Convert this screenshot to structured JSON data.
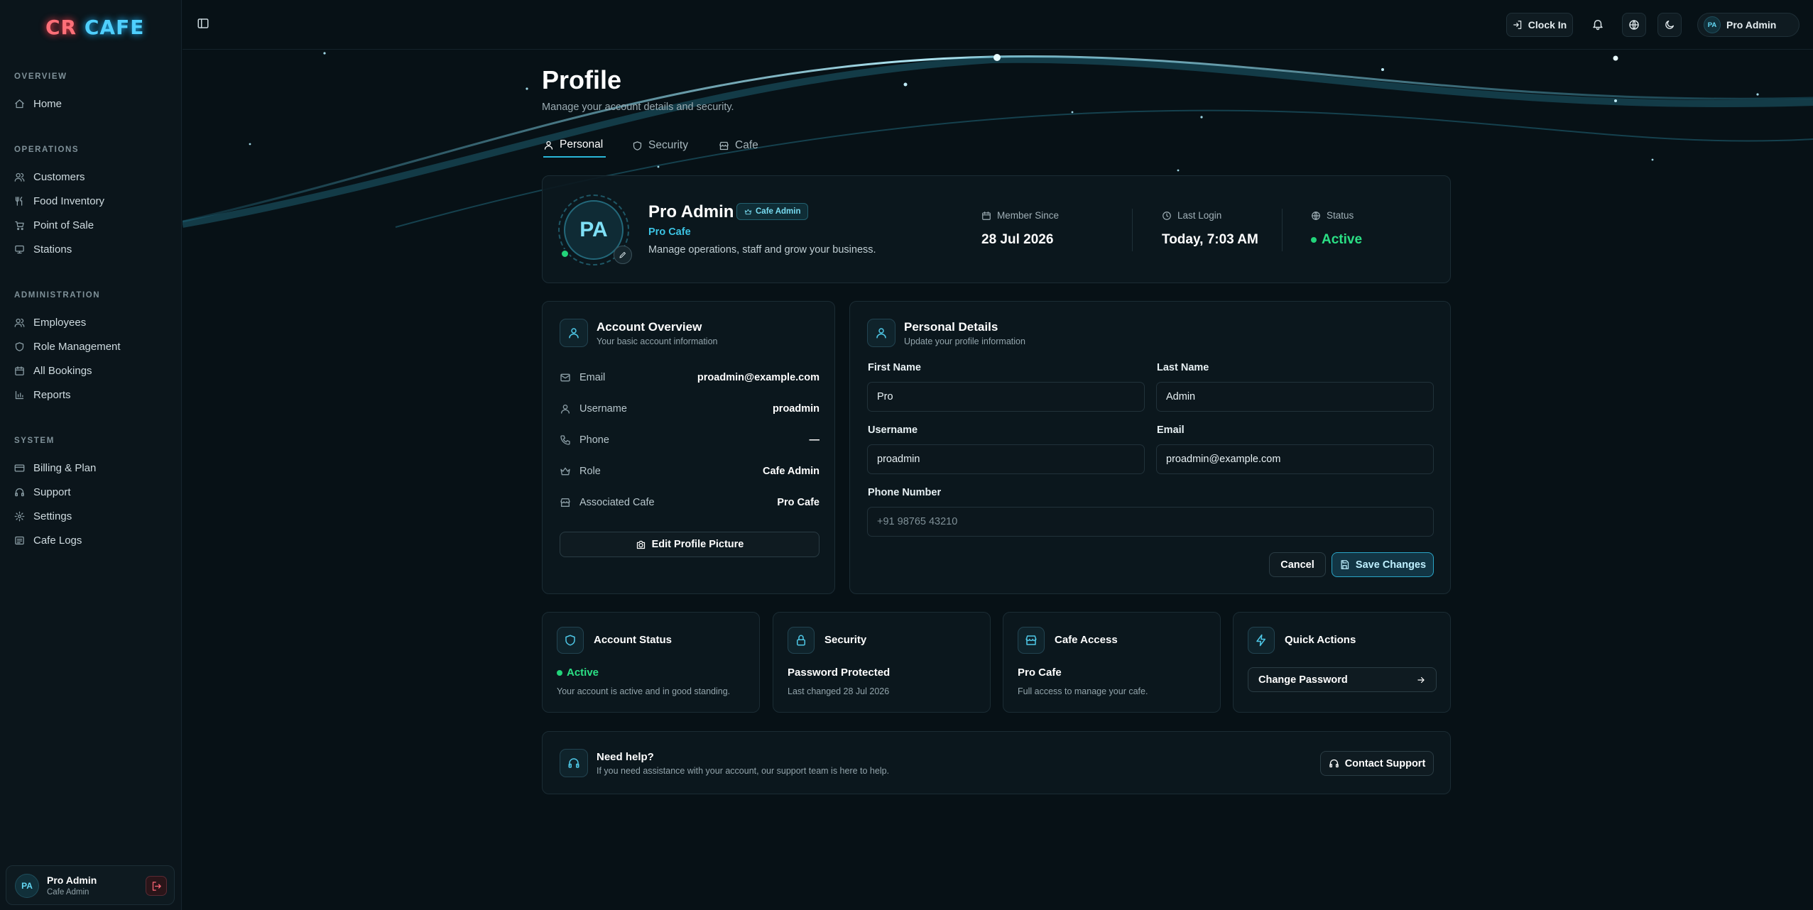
{
  "brand": {
    "logo_left": "CR",
    "logo_right": "CAFE"
  },
  "sidebar": {
    "sections": [
      {
        "title": "OVERVIEW",
        "items": [
          {
            "label": "Home",
            "icon": "home-icon"
          }
        ]
      },
      {
        "title": "OPERATIONS",
        "items": [
          {
            "label": "Customers",
            "icon": "users-icon"
          },
          {
            "label": "Food Inventory",
            "icon": "utensils-icon"
          },
          {
            "label": "Point of Sale",
            "icon": "cart-icon"
          },
          {
            "label": "Stations",
            "icon": "monitor-icon"
          }
        ]
      },
      {
        "title": "ADMINISTRATION",
        "items": [
          {
            "label": "Employees",
            "icon": "users-icon"
          },
          {
            "label": "Role Management",
            "icon": "shield-icon"
          },
          {
            "label": "All Bookings",
            "icon": "calendar-icon"
          },
          {
            "label": "Reports",
            "icon": "bar-chart-icon"
          }
        ]
      },
      {
        "title": "SYSTEM",
        "items": [
          {
            "label": "Billing & Plan",
            "icon": "credit-card-icon"
          },
          {
            "label": "Support",
            "icon": "headphones-icon"
          },
          {
            "label": "Settings",
            "icon": "gear-icon"
          },
          {
            "label": "Cafe Logs",
            "icon": "list-icon"
          }
        ]
      }
    ],
    "user": {
      "initials": "PA",
      "name": "Pro Admin",
      "role": "Cafe Admin"
    }
  },
  "header": {
    "clock_in": "Clock In",
    "user_initials": "PA",
    "user_name": "Pro Admin"
  },
  "page": {
    "title": "Profile",
    "subtitle": "Manage your account details and security."
  },
  "tabs": [
    {
      "label": "Personal",
      "icon": "user-icon",
      "active": true
    },
    {
      "label": "Security",
      "icon": "shield-icon",
      "active": false
    },
    {
      "label": "Cafe",
      "icon": "store-icon",
      "active": false
    }
  ],
  "profile": {
    "initials": "PA",
    "name": "Pro Admin",
    "badge": "Cafe Admin",
    "cafe": "Pro Cafe",
    "tagline": "Manage operations, staff and grow your business.",
    "stats": [
      {
        "label": "Member Since",
        "value": "28 Jul 2026",
        "icon": "calendar-icon"
      },
      {
        "label": "Last Login",
        "value": "Today, 7:03 AM",
        "icon": "clock-icon"
      },
      {
        "label": "Status",
        "value": "Active",
        "icon": "globe-icon"
      }
    ]
  },
  "account_overview": {
    "title": "Account Overview",
    "subtitle": "Your basic account information",
    "rows": [
      {
        "label": "Email",
        "value": "proadmin@example.com",
        "icon": "mail-icon"
      },
      {
        "label": "Username",
        "value": "proadmin",
        "icon": "user-icon"
      },
      {
        "label": "Phone",
        "value": "—",
        "icon": "phone-icon"
      },
      {
        "label": "Role",
        "value": "Cafe Admin",
        "icon": "crown-icon"
      },
      {
        "label": "Associated Cafe",
        "value": "Pro Cafe",
        "icon": "store-icon"
      }
    ],
    "edit_picture": "Edit Profile Picture"
  },
  "personal_details": {
    "title": "Personal Details",
    "subtitle": "Update your profile information",
    "first_name_label": "First Name",
    "first_name": "Pro",
    "last_name_label": "Last Name",
    "last_name": "Admin",
    "username_label": "Username",
    "username": "proadmin",
    "email_label": "Email",
    "email": "proadmin@example.com",
    "phone_label": "Phone Number",
    "phone_placeholder": "+91 98765 43210",
    "cancel": "Cancel",
    "save": "Save Changes"
  },
  "summary_cards": [
    {
      "title": "Account Status",
      "value": "Active",
      "desc": "Your account is active and in good standing.",
      "icon": "shield-icon"
    },
    {
      "title": "Security",
      "value": "Password Protected",
      "desc": "Last changed 28 Jul 2026",
      "icon": "lock-icon"
    },
    {
      "title": "Cafe Access",
      "value": "Pro Cafe",
      "desc": "Full access to manage your cafe.",
      "icon": "store-icon"
    },
    {
      "title": "Quick Actions",
      "action": "Change Password",
      "icon": "zap-icon"
    }
  ],
  "help": {
    "title": "Need help?",
    "desc": "If you need assistance with your account, our support team is here to help.",
    "button": "Contact Support"
  },
  "colors": {
    "accent": "#29b6d8",
    "success": "#22d47a",
    "background": "#071116",
    "logo_red": "#ff6f78",
    "logo_blue": "#4fd0ff"
  }
}
